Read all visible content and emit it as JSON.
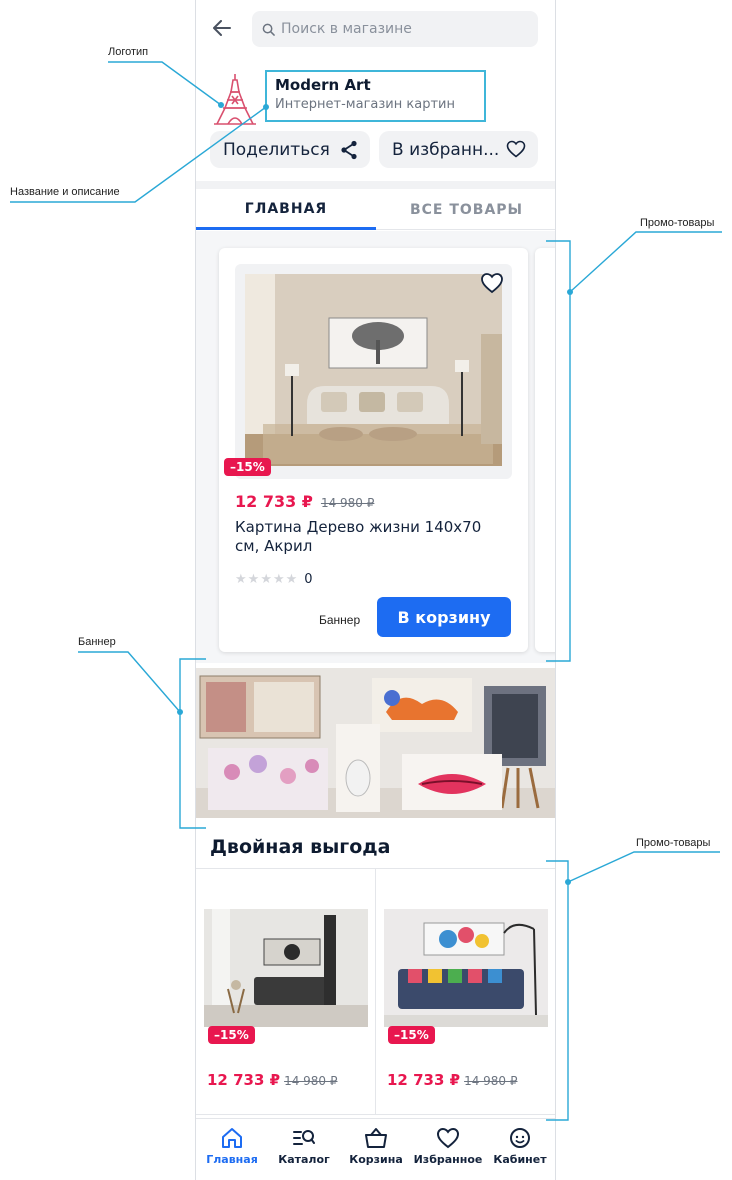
{
  "annotations": {
    "logo": "Логотип",
    "name_desc": "Название и описание",
    "promo_top": "Промо-товары",
    "banner": "Баннер",
    "promo_bottom": "Промо-товары"
  },
  "search": {
    "placeholder": "Поиск в магазине"
  },
  "store": {
    "name": "Modern Art",
    "description": "Интернет-магазин картин"
  },
  "actions": {
    "share_label": "Поделиться",
    "favorite_label": "В избранн..."
  },
  "tabs": [
    {
      "label": "ГЛАВНАЯ",
      "active": true
    },
    {
      "label": "ВСЕ ТОВАРЫ",
      "active": false
    }
  ],
  "promo_card": {
    "discount": "–15%",
    "price_new": "12 733 ₽",
    "price_old": "14 980 ₽",
    "title": "Картина  Дерево жизни 140х70 см, Акрил",
    "rating_count": "0",
    "banner_note": "Баннер",
    "cart_button": "В корзину"
  },
  "section": {
    "title": "Двойная выгода"
  },
  "grid_items": [
    {
      "discount": "–15%",
      "price_new": "12 733 ₽",
      "price_old": "14 980 ₽"
    },
    {
      "discount": "–15%",
      "price_new": "12 733 ₽",
      "price_old": "14 980 ₽"
    }
  ],
  "nav": [
    {
      "label": "Главная",
      "icon": "home-icon",
      "active": true
    },
    {
      "label": "Каталог",
      "icon": "catalog-search-icon",
      "active": false
    },
    {
      "label": "Корзина",
      "icon": "basket-icon",
      "active": false
    },
    {
      "label": "Избранное",
      "icon": "heart-icon",
      "active": false
    },
    {
      "label": "Кабинет",
      "icon": "smile-profile-icon",
      "active": false
    }
  ],
  "colors": {
    "accent": "#1d6cf2",
    "sale": "#e8174f",
    "annotation_line": "#2aa8d6",
    "highlight_box": "#3fb6d9"
  }
}
